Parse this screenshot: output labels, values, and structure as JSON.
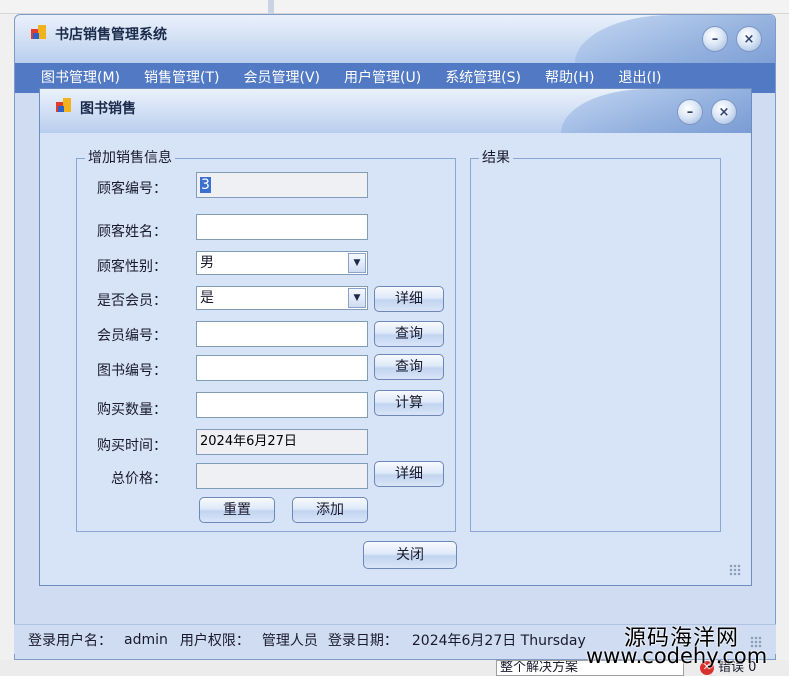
{
  "main_window": {
    "title": "书店销售管理系统",
    "minimize_glyph": "–",
    "close_glyph": "×"
  },
  "menu": [
    {
      "label": "图书管理(M)"
    },
    {
      "label": "销售管理(T)"
    },
    {
      "label": "会员管理(V)"
    },
    {
      "label": "用户管理(U)"
    },
    {
      "label": "系统管理(S)"
    },
    {
      "label": "帮助(H)"
    },
    {
      "label": "退出(I)"
    }
  ],
  "child_window": {
    "title": "图书销售",
    "minimize_glyph": "–",
    "close_glyph": "×"
  },
  "form": {
    "group_title": "增加销售信息",
    "customer_id_label": "顾客编号：",
    "customer_id_value": "3",
    "customer_name_label": "顾客姓名：",
    "customer_name_value": "",
    "gender_label": "顾客性别：",
    "gender_value": "男",
    "is_member_label": "是否会员：",
    "is_member_value": "是",
    "member_detail_button": "详细",
    "member_id_label": "会员编号：",
    "member_id_value": "",
    "member_query_button": "查询",
    "book_id_label": "图书编号：",
    "book_id_value": "",
    "book_query_button": "查询",
    "quantity_label": "购买数量：",
    "quantity_value": "",
    "calculate_button": "计算",
    "purchase_time_label": "购买时间：",
    "purchase_time_value": "2024年6月27日",
    "total_price_label": "总价格：",
    "total_price_value": "",
    "price_detail_button": "详细",
    "reset_button": "重置",
    "add_button": "添加"
  },
  "result": {
    "group_title": "结果"
  },
  "close_button": "关闭",
  "statusbar": {
    "user_label": "登录用户名：",
    "user_value": "admin",
    "role_label": "用户权限：",
    "role_value": "管理人员",
    "date_label": "登录日期：",
    "date_value": "2024年6月27日 Thursday"
  },
  "watermark": {
    "line1": "源码海洋网",
    "line2": "www.codehy.com"
  },
  "ide": {
    "solution_combo": "整个解决方案",
    "error_text": "错误 0"
  },
  "colors": {
    "menubar": "#5179c4",
    "window_bg": "#cfdcf2",
    "child_bg": "#d7e3f7",
    "selection": "#3b6fd1"
  }
}
